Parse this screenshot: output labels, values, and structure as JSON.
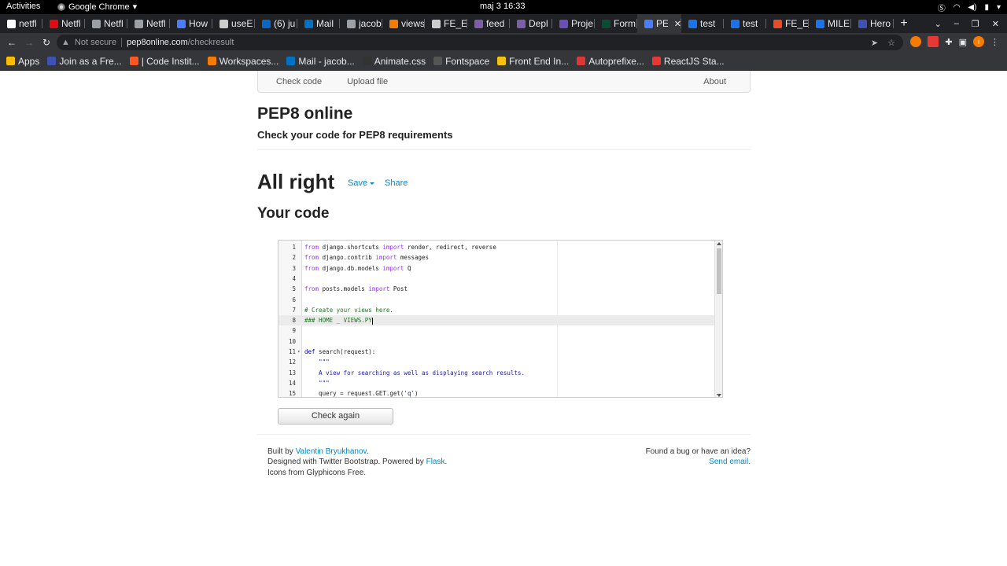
{
  "system_bar": {
    "activities": "Activities",
    "app_name": "Google Chrome",
    "clock": "maj 3  16:33"
  },
  "tabs": [
    {
      "label": "netfl",
      "color": "#ffffff"
    },
    {
      "label": "Netfl",
      "color": "#e50914"
    },
    {
      "label": "Netfl",
      "color": "#9aa0a6"
    },
    {
      "label": "Netfl",
      "color": "#9aa0a6"
    },
    {
      "label": "How",
      "color": "#4a7cff"
    },
    {
      "label": "useE",
      "color": "#cccccc"
    },
    {
      "label": "(6) ju",
      "color": "#0a66c2"
    },
    {
      "label": "Mail",
      "color": "#0072c6"
    },
    {
      "label": "jacob",
      "color": "#9aa0a6"
    },
    {
      "label": "views",
      "color": "#f57c00"
    },
    {
      "label": "FE_E",
      "color": "#cccccc"
    },
    {
      "label": "feed",
      "color": "#7b5ea7"
    },
    {
      "label": "Depl",
      "color": "#7b5ea7"
    },
    {
      "label": "Proje",
      "color": "#6a4fb8"
    },
    {
      "label": "Form",
      "color": "#0c4b33"
    },
    {
      "label": "PE",
      "color": "#4a7cff",
      "active": true
    },
    {
      "label": "test",
      "color": "#1a73e8"
    },
    {
      "label": "test",
      "color": "#1a73e8"
    },
    {
      "label": "FE_E",
      "color": "#e44d26"
    },
    {
      "label": "MILE",
      "color": "#1a73e8"
    },
    {
      "label": "Hero",
      "color": "#3f51b5"
    }
  ],
  "browser": {
    "not_secure": "Not secure",
    "url_host": "pep8online.com",
    "url_path": "/checkresult"
  },
  "bookmarks": [
    {
      "label": "Apps",
      "color": "#fbbc04"
    },
    {
      "label": "Join as a Fre...",
      "color": "#3f51b5"
    },
    {
      "label": "| Code Instit...",
      "color": "#ff5722"
    },
    {
      "label": "Workspaces...",
      "color": "#f57c00"
    },
    {
      "label": "Mail - jacob...",
      "color": "#0072c6"
    },
    {
      "label": "Animate.css",
      "color": "#333333"
    },
    {
      "label": "Fontspace",
      "color": "#555555"
    },
    {
      "label": "Front End In...",
      "color": "#f4c20d"
    },
    {
      "label": "Autoprefixe...",
      "color": "#dd3735"
    },
    {
      "label": "ReactJS Sta...",
      "color": "#e53935"
    }
  ],
  "nav": {
    "check_code": "Check code",
    "upload_file": "Upload file",
    "about": "About"
  },
  "header": {
    "title": "PEP8 online",
    "subtitle": "Check your code for PEP8 requirements"
  },
  "result": {
    "status": "All right",
    "save": "Save",
    "share": "Share",
    "your_code": "Your code"
  },
  "code_lines": [
    {
      "n": "1",
      "html": "<span class=\"kw\">from</span> django.shortcuts <span class=\"kw\">import</span> render, redirect, reverse"
    },
    {
      "n": "2",
      "html": "<span class=\"kw\">from</span> django.contrib <span class=\"kw\">import</span> messages"
    },
    {
      "n": "3",
      "html": "<span class=\"kw\">from</span> django.db.models <span class=\"kw\">import</span> Q"
    },
    {
      "n": "4",
      "html": ""
    },
    {
      "n": "5",
      "html": "<span class=\"kw\">from</span> posts.models <span class=\"kw\">import</span> Post"
    },
    {
      "n": "6",
      "html": ""
    },
    {
      "n": "7",
      "html": "<span class=\"cm\"># Create your views here.</span>"
    },
    {
      "n": "8",
      "html": "<span class=\"cm\">### HOME _ VIEWS.PY</span><span class=\"cursor\"></span>",
      "current": true
    },
    {
      "n": "9",
      "html": ""
    },
    {
      "n": "10",
      "html": ""
    },
    {
      "n": "11",
      "html": "<span class=\"kw2\">def</span> search(request):",
      "fold": true
    },
    {
      "n": "12",
      "html": "    <span class=\"str\">\"\"\"</span>"
    },
    {
      "n": "13",
      "html": "    <span class=\"str\">A view for searching as well as displaying search results.</span>"
    },
    {
      "n": "14",
      "html": "    <span class=\"str\">\"\"\"</span>"
    },
    {
      "n": "15",
      "html": "    query = request.GET.get(<span class=\"str\">'q'</span>)"
    }
  ],
  "check_again": "Check again",
  "footer": {
    "built_by_prefix": "Built by ",
    "author": "Valentin Bryukhanov",
    "built_by_suffix": ".",
    "designed_prefix": "Designed with Twitter Bootstrap. Powered by ",
    "flask": "Flask",
    "designed_suffix": ".",
    "icons": "Icons from Glyphicons Free.",
    "bug": "Found a bug or have an idea?",
    "send_email": "Send email."
  }
}
